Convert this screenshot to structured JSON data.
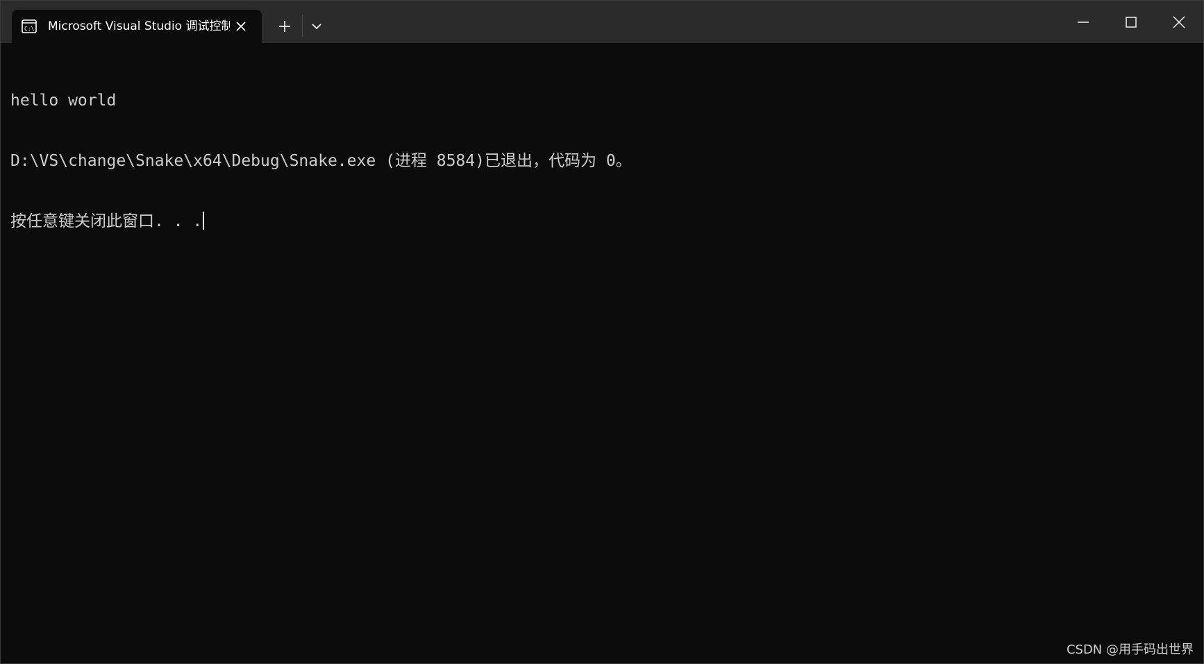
{
  "tab": {
    "title": "Microsoft Visual Studio 调试控制台",
    "icon": "console-icon"
  },
  "titlebar": {
    "new_tab_icon": "plus-icon",
    "dropdown_icon": "chevron-down-icon",
    "minimize_icon": "minimize-icon",
    "maximize_icon": "maximize-icon",
    "close_icon": "close-icon"
  },
  "terminal": {
    "lines": [
      "hello world",
      "D:\\VS\\change\\Snake\\x64\\Debug\\Snake.exe (进程 8584)已退出，代码为 0。",
      "按任意键关闭此窗口. . ."
    ]
  },
  "watermark": "CSDN @用手码出世界",
  "colors": {
    "titlebar_bg": "#2b2b2b",
    "terminal_bg": "#0c0c0c",
    "text": "#cccccc"
  }
}
